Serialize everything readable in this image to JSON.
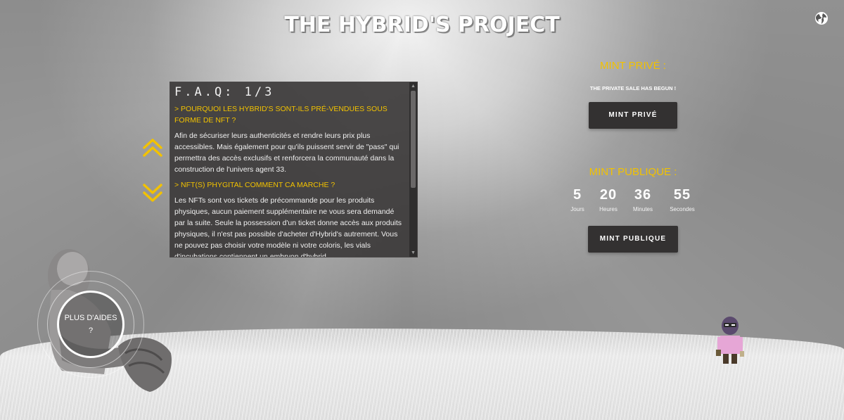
{
  "header": {
    "title": "THE HYBRID'S PROJECT"
  },
  "faq": {
    "title": "F.A.Q: 1/3",
    "items": [
      {
        "question": "> POURQUOI LES HYBRID'S SONT-ILS PRÉ-VENDUES SOUS FORME DE NFT ?",
        "answer": "Afin de sécuriser leurs authenticités et rendre leurs prix plus accessibles. Mais également pour qu'ils puissent servir de \"pass\" qui permettra des accès exclusifs et renforcera la communauté dans la construction de l'univers agent 33."
      },
      {
        "question": "> NFT(S) PHYGITAL COMMENT CA MARCHE ?",
        "answer": "Les NFTs sont vos tickets de précommande pour les produits physiques, aucun paiement supplémentaire ne vous sera demandé par la suite. Seule la possession d'un ticket donne accès aux produits physiques, il n'est pas possible d'acheter d'Hybrid's autrement. Vous ne pouvez pas choisir votre modèle ni votre coloris, les vials d'incubations contiennent un embryon d'hybrid"
      }
    ]
  },
  "mint_private": {
    "heading": "MINT PRIVÉ :",
    "status": "THE PRIVATE SALE HAS BEGUN !",
    "button_label": "MINT PRIVÉ"
  },
  "mint_public": {
    "heading": "MINT PUBLIQUE :",
    "countdown": [
      {
        "value": "5",
        "label": "Jours"
      },
      {
        "value": "20",
        "label": "Heures"
      },
      {
        "value": "36",
        "label": "Minutes"
      },
      {
        "value": "55",
        "label": "Secondes"
      }
    ],
    "button_label": "MINT PUBLIQUE"
  },
  "help": {
    "label": "PLUS D'AIDES ?"
  },
  "icons": {
    "language": "globe-icon",
    "faq_prev": "chevron-up-icon",
    "faq_next": "chevron-down-icon"
  },
  "colors": {
    "accent": "#f2c200",
    "panel": "#3c3a3a",
    "button": "#333131"
  }
}
